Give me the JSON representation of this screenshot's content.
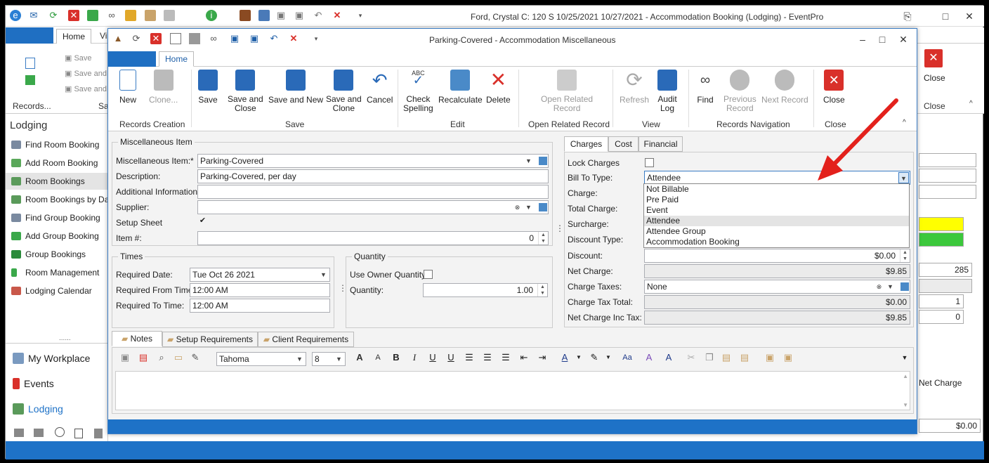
{
  "outer": {
    "title": "Ford, Crystal C: 120 S 10/25/2021 10/27/2021  - Accommodation Booking (Lodging) - EventPro",
    "home_tab": "Home",
    "tab2": "Vie",
    "save": "Save",
    "save_and": "Save and",
    "save_and2": "Save and",
    "records": "Records...",
    "sa": "Sa",
    "close": "Close",
    "close_group": "Close",
    "lodging_title": "Lodging",
    "nav_items": [
      "Find Room Booking",
      "Add Room Booking",
      "Room Bookings",
      "Room Bookings by Day",
      "Find Group Booking",
      "Add Group Booking",
      "Group Bookings",
      "Room Management",
      "Lodging Calendar"
    ],
    "workplace": "My Workplace",
    "events": "Events",
    "lodging": "Lodging",
    "dots": "......",
    "rp_285": "285",
    "rp_1": "1",
    "rp_0": "0",
    "net_charge": "Net Charge",
    "rp_amount": "$0.00"
  },
  "dialog": {
    "title": "Parking-Covered - Accommodation Miscellaneous",
    "home_tab": "Home",
    "ribbon": {
      "new": "New",
      "clone": "Clone...",
      "save": "Save",
      "save_close_1": "Save and",
      "save_close_2": "Close",
      "save_new": "Save and New",
      "save_clone_1": "Save and",
      "save_clone_2": "Clone",
      "cancel": "Cancel",
      "check_1": "Check",
      "check_2": "Spelling",
      "recalculate": "Recalculate",
      "delete": "Delete",
      "open_related_1": "Open Related",
      "open_related_2": "Record",
      "refresh": "Refresh",
      "audit_1": "Audit",
      "audit_2": "Log",
      "find": "Find",
      "prev_1": "Previous",
      "prev_2": "Record",
      "next": "Next Record",
      "close": "Close",
      "g_records": "Records Creation",
      "g_save": "Save",
      "g_edit": "Edit",
      "g_open": "Open Related Record",
      "g_view": "View",
      "g_nav": "Records Navigation",
      "g_close": "Close",
      "abc": "ABC"
    },
    "misc": {
      "title": "Miscellaneous Item",
      "item_label": "Miscellaneous Item:*",
      "item_value": "Parking-Covered",
      "desc_label": "Description:",
      "desc_value": "Parking-Covered, per day",
      "addl_label": "Additional Information:",
      "supplier_label": "Supplier:",
      "setup_label": "Setup Sheet",
      "itemno_label": "Item #:",
      "itemno_value": "0"
    },
    "times": {
      "title": "Times",
      "req_date_label": "Required Date:",
      "req_date": "Tue Oct 26 2021",
      "from_label": "Required From Time:",
      "from": "12:00 AM",
      "to_label": "Required To Time:",
      "to": "12:00 AM"
    },
    "quantity": {
      "title": "Quantity",
      "owner_label": "Use Owner Quantity",
      "qty_label": "Quantity:",
      "qty": "1.00"
    },
    "charges": {
      "tabs": [
        "Charges",
        "Cost",
        "Financial"
      ],
      "lock": "Lock Charges",
      "bill_to_label": "Bill To Type:",
      "bill_to": "Attendee",
      "options": [
        "Not Billable",
        "Pre Paid",
        "Event",
        "Attendee",
        "Attendee Group",
        "Accommodation Booking"
      ],
      "selected_option": "Attendee",
      "charge_label": "Charge:",
      "total_label": "Total Charge:",
      "surcharge_label": "Surcharge:",
      "disc_type_label": "Discount Type:",
      "discount_label": "Discount:",
      "discount": "$0.00",
      "net_label": "Net Charge:",
      "net": "$9.85",
      "taxes_label": "Charge Taxes:",
      "taxes": "None",
      "tax_total_label": "Charge Tax Total:",
      "tax_total": "$0.00",
      "net_inc_label": "Net Charge Inc Tax:",
      "net_inc": "$9.85"
    },
    "notes": {
      "tabs": [
        "Notes",
        "Setup Requirements",
        "Client Requirements"
      ],
      "font": "Tahoma",
      "size": "8"
    }
  },
  "colors": {
    "accent": "#1e72c7",
    "close_red": "#d9302a",
    "arrow": "#e3211c"
  }
}
